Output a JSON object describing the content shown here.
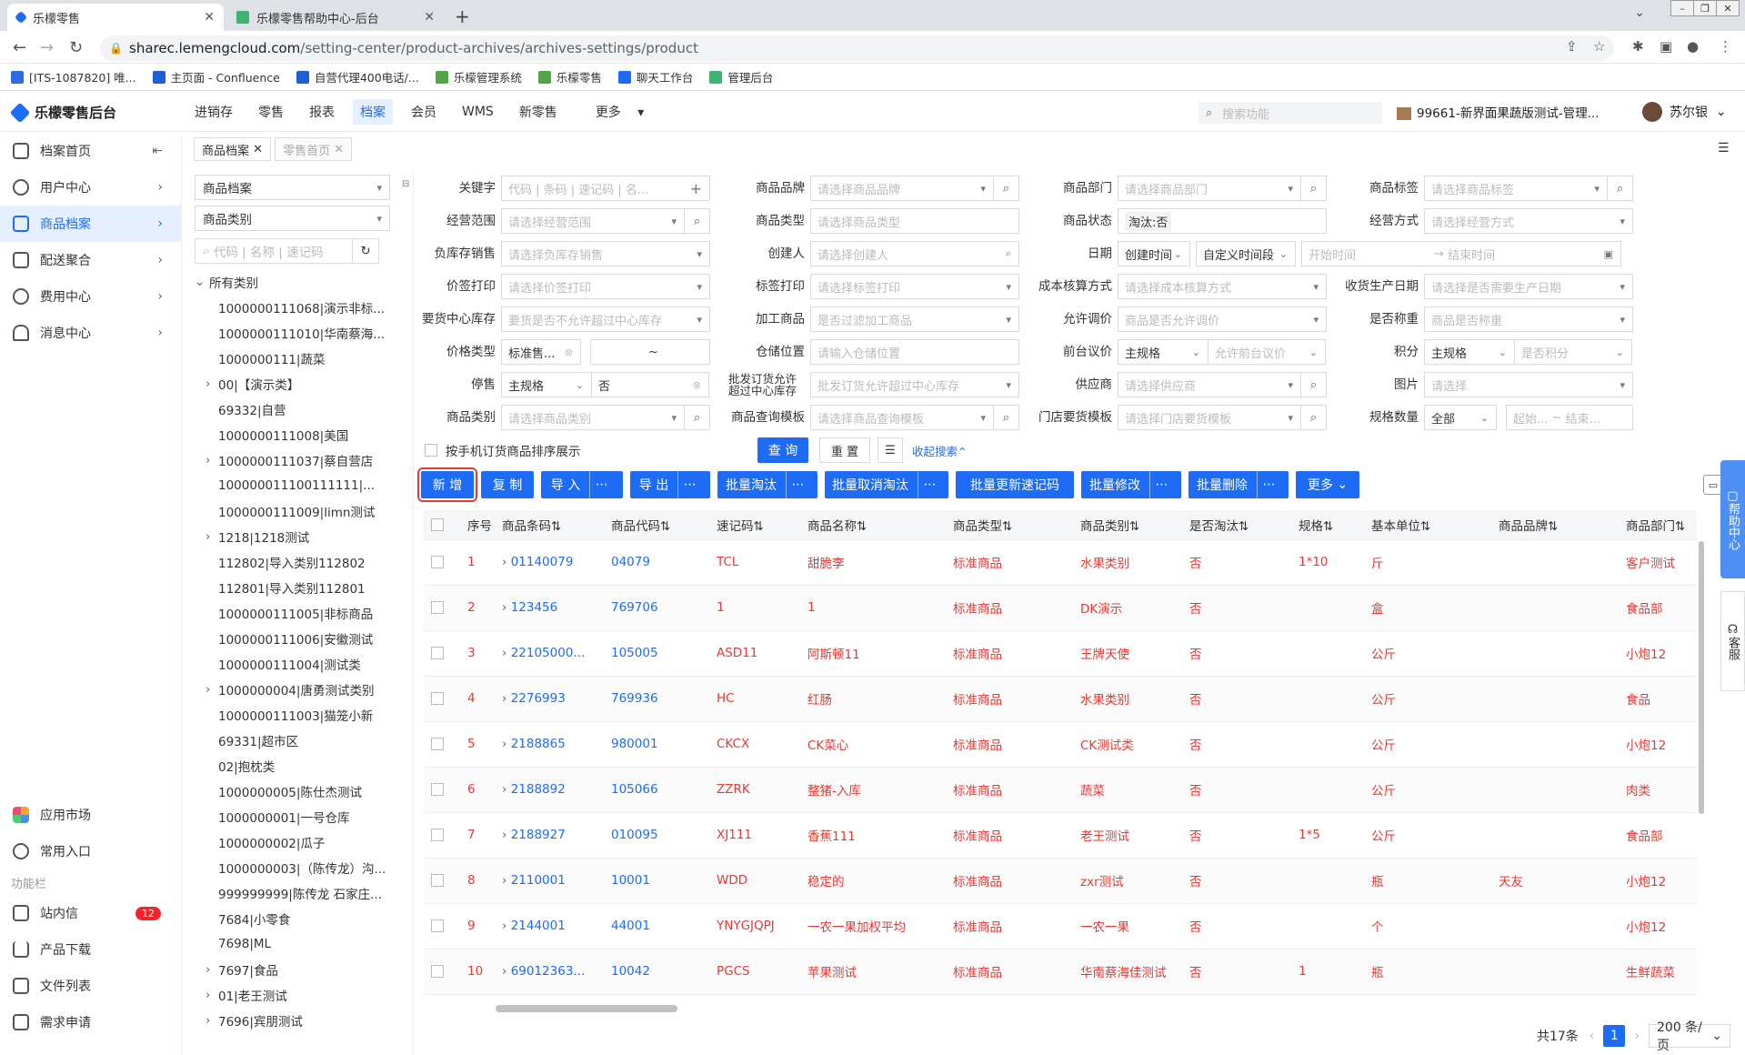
{
  "browser": {
    "tabs": [
      {
        "title": "乐檬零售"
      },
      {
        "title": "乐檬零售帮助中心-后台"
      }
    ],
    "url_host": "sharec.lemengcloud.com",
    "url_path": "/setting-center/product-archives/archives-settings/product",
    "bookmarks": [
      "[ITS-1087820] 唯...",
      "主页面 - Confluence",
      "自营代理400电话/...",
      "乐檬管理系统",
      "乐檬零售",
      "聊天工作台",
      "管理后台"
    ]
  },
  "app": {
    "title": "乐檬零售后台",
    "topnav": [
      "进销存",
      "零售",
      "报表",
      "档案",
      "会员",
      "WMS",
      "新零售",
      "更多"
    ],
    "search_placeholder": "搜索功能",
    "store": "99661-新界面果蔬版测试-管理...",
    "user": "苏尔银"
  },
  "sidebar": {
    "items": [
      {
        "label": "档案首页"
      },
      {
        "label": "用户中心"
      },
      {
        "label": "商品档案"
      },
      {
        "label": "配送聚合"
      },
      {
        "label": "费用中心"
      },
      {
        "label": "消息中心"
      }
    ],
    "bottom": [
      {
        "label": "应用市场"
      },
      {
        "label": "常用入口"
      }
    ],
    "section": "功能栏",
    "func": [
      {
        "label": "站内信",
        "badge": "12"
      },
      {
        "label": "产品下载"
      },
      {
        "label": "文件列表"
      },
      {
        "label": "需求申请"
      }
    ]
  },
  "pagetabs": [
    "商品档案",
    "零售首页"
  ],
  "tree": {
    "select1": "商品档案",
    "select2": "商品类别",
    "search_placeholder": "代码 | 名称 | 速记码",
    "root": "所有类别",
    "items": [
      {
        "t": "1000000111068|演示非标..."
      },
      {
        "t": "1000000111010|华南蔡海..."
      },
      {
        "t": "1000000111|蔬菜"
      },
      {
        "t": "00|【演示类】"
      },
      {
        "t": "69332|自营"
      },
      {
        "t": "1000000111008|美国"
      },
      {
        "t": "1000000111037|蔡自营店"
      },
      {
        "t": "100000011100111111|..."
      },
      {
        "t": "1000000111009|limn测试"
      },
      {
        "t": "1218|1218测试"
      },
      {
        "t": "112802|导入类别112802"
      },
      {
        "t": "112801|导入类别112801"
      },
      {
        "t": "1000000111005|非标商品"
      },
      {
        "t": "1000000111006|安徽测试"
      },
      {
        "t": "1000000111004|测试类"
      },
      {
        "t": "1000000004|唐勇测试类别"
      },
      {
        "t": "1000000111003|猫笼小新"
      },
      {
        "t": "69331|超市区"
      },
      {
        "t": "02|抱枕类"
      },
      {
        "t": "1000000005|陈仕杰测试"
      },
      {
        "t": "1000000001|一号仓库"
      },
      {
        "t": "1000000002|瓜子"
      },
      {
        "t": "1000000003|（陈传龙）沟..."
      },
      {
        "t": "999999999|陈传龙 石家庄..."
      },
      {
        "t": "7684|小零食"
      },
      {
        "t": "7698|ML"
      },
      {
        "t": "7697|食品"
      },
      {
        "t": "01|老王测试"
      },
      {
        "t": "7696|宾朋测试"
      }
    ]
  },
  "filters": {
    "row1": [
      {
        "label": "关键字",
        "ph": "代码 | 条码 | 速记码 | 名..."
      },
      {
        "label": "商品品牌",
        "ph": "请选择商品品牌"
      },
      {
        "label": "商品部门",
        "ph": "请选择商品部门"
      },
      {
        "label": "商品标签",
        "ph": "请选择商品标签"
      }
    ],
    "row2": [
      {
        "label": "经营范围",
        "ph": "请选择经营范围"
      },
      {
        "label": "商品类型",
        "ph": "请选择商品类型"
      },
      {
        "label": "商品状态",
        "val": "淘汰:否"
      },
      {
        "label": "经营方式",
        "ph": "请选择经营方式"
      }
    ],
    "row3": [
      {
        "label": "负库存销售",
        "ph": "请选择负库存销售"
      },
      {
        "label": "创建人",
        "ph": "请选择创建人"
      },
      {
        "label": "日期",
        "v1": "创建时间",
        "v2": "自定义时间段",
        "ph1": "开始时间",
        "ph2": "结束时间"
      }
    ],
    "row4": [
      {
        "label": "价签打印",
        "ph": "请选择价签打印"
      },
      {
        "label": "标签打印",
        "ph": "请选择标签打印"
      },
      {
        "label": "成本核算方式",
        "ph": "请选择成本核算方式"
      },
      {
        "label": "收货生产日期",
        "ph": "请选择是否需要生产日期"
      }
    ],
    "row5": [
      {
        "label": "要货中心库存",
        "ph": "要货是否不允许超过中心库存"
      },
      {
        "label": "加工商品",
        "ph": "是否过滤加工商品"
      },
      {
        "label": "允许调价",
        "ph": "商品是否允许调价"
      },
      {
        "label": "是否称重",
        "ph": "商品是否称重"
      }
    ],
    "row6": [
      {
        "label": "价格类型",
        "val": "标准售...",
        "sep": "~"
      },
      {
        "label": "仓储位置",
        "ph": "请输入仓储位置"
      },
      {
        "label": "前台议价",
        "val": "主规格",
        "ph": "允许前台议价"
      },
      {
        "label": "积分",
        "val": "主规格",
        "ph": "是否积分"
      }
    ],
    "row7": [
      {
        "label": "停售",
        "val": "主规格",
        "val2": "否"
      },
      {
        "label": "批发订货允许超过中心库存",
        "ph": "批发订货允许超过中心库存"
      },
      {
        "label": "供应商",
        "ph": "请选择供应商"
      },
      {
        "label": "图片",
        "ph": "请选择"
      }
    ],
    "row8": [
      {
        "label": "商品类别",
        "ph": "请选择商品类别"
      },
      {
        "label": "商品查询模板",
        "ph": "请选择商品查询模板"
      },
      {
        "label": "门店要货模板",
        "ph": "请选择门店要货模板"
      },
      {
        "label": "规格数量",
        "val": "全部",
        "ph": "起始...",
        "ph2": "结束..."
      }
    ],
    "sort_label": "按手机订货商品排序展示",
    "query": "查 询",
    "reset": "重 置",
    "collapse": "收起搜索"
  },
  "buttons": [
    "新 增",
    "复 制",
    "导 入",
    "导 出",
    "批量淘汰",
    "批量取消淘汰",
    "批量更新速记码",
    "批量修改",
    "批量删除",
    "更多"
  ],
  "table": {
    "headers": [
      "序号",
      "商品条码",
      "商品代码",
      "速记码",
      "商品名称",
      "商品类型",
      "商品类别",
      "是否淘汰",
      "规格",
      "基本单位",
      "商品品牌",
      "商品部门"
    ],
    "rows": [
      [
        "1",
        "01140079",
        "04079",
        "TCL",
        "甜脆李",
        "标准商品",
        "水果类别",
        "否",
        "1*10",
        "斤",
        "",
        "客户测试"
      ],
      [
        "2",
        "123456",
        "769706",
        "1",
        "1",
        "标准商品",
        "DK演示",
        "否",
        "",
        "盒",
        "",
        "食品部"
      ],
      [
        "3",
        "22105000...",
        "105005",
        "ASD11",
        "阿斯顿11",
        "标准商品",
        "王牌天使",
        "否",
        "",
        "公斤",
        "",
        "小炮12"
      ],
      [
        "4",
        "2276993",
        "769936",
        "HC",
        "红肠",
        "标准商品",
        "水果类别",
        "否",
        "",
        "公斤",
        "",
        "食品"
      ],
      [
        "5",
        "2188865",
        "980001",
        "CKCX",
        "CK菜心",
        "标准商品",
        "CK测试类",
        "否",
        "",
        "公斤",
        "",
        "小炮12"
      ],
      [
        "6",
        "2188892",
        "105066",
        "ZZRK",
        "整猪-入库",
        "标准商品",
        "蔬菜",
        "否",
        "",
        "公斤",
        "",
        "肉类"
      ],
      [
        "7",
        "2188927",
        "010095",
        "XJ111",
        "香蕉111",
        "标准商品",
        "老王测试",
        "否",
        "1*5",
        "公斤",
        "",
        "食品部"
      ],
      [
        "8",
        "2110001",
        "10001",
        "WDD",
        "稳定的",
        "标准商品",
        "zxr测试",
        "否",
        "",
        "瓶",
        "天友",
        "小炮12"
      ],
      [
        "9",
        "2144001",
        "44001",
        "YNYGJQPJ",
        "一农一果加权平均",
        "标准商品",
        "一农一果",
        "否",
        "",
        "个",
        "",
        "小炮12"
      ],
      [
        "10",
        "69012363...",
        "10042",
        "PGCS",
        "苹果测试",
        "标准商品",
        "华南蔡海佳测试",
        "否",
        "1",
        "瓶",
        "",
        "生鲜蔬菜"
      ]
    ]
  },
  "pager": {
    "total": "共17条",
    "page": "1",
    "size": "200 条/页"
  },
  "float": {
    "help": "帮助中心",
    "kefu": "客服"
  }
}
